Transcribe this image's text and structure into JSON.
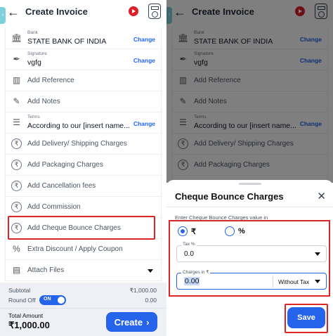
{
  "colors": {
    "accent": "#2563eb",
    "highlight": "#dc2626",
    "youtube": "#e11d2a"
  },
  "header": {
    "title": "Create Invoice"
  },
  "items": [
    {
      "small": "Bank",
      "value": "STATE BANK OF INDIA",
      "action": "Change",
      "icon": "bank-icon"
    },
    {
      "small": "Signature",
      "value": "vgfg",
      "action": "Change",
      "icon": "signature-icon"
    },
    {
      "label": "Add Reference",
      "icon": "reference-icon"
    },
    {
      "label": "Add Notes",
      "icon": "notes-icon"
    },
    {
      "small": "Terms",
      "value": "According to our [insert name...",
      "action": "Change",
      "icon": "terms-icon"
    },
    {
      "label": "Add Delivery/ Shipping Charges",
      "icon": "rupee-icon"
    },
    {
      "label": "Add Packaging Charges",
      "icon": "rupee-icon"
    },
    {
      "label": "Add Cancellation fees",
      "icon": "rupee-icon"
    },
    {
      "label": "Add Commission",
      "icon": "rupee-icon"
    },
    {
      "label": "Add Cheque Bounce Charges",
      "icon": "rupee-icon"
    },
    {
      "label": "Extra Discount / Apply Coupon",
      "icon": "percent-icon"
    },
    {
      "label": "Attach Files",
      "icon": "attach-icon"
    }
  ],
  "summary": {
    "subtotal_label": "Subtotal",
    "subtotal_value": "₹1,000.00",
    "roundoff_label": "Round Off",
    "roundoff_toggle": "ON",
    "roundoff_value": "0.00",
    "total_label": "Total Amount",
    "total_value": "₹1,000.00",
    "create_label": "Create"
  },
  "sheet": {
    "title": "Cheque Bounce Charges",
    "hint": "Enter Cheque Bounce Charges value in",
    "option_rupee": "₹",
    "option_percent": "%",
    "tax_label": "Tax %",
    "tax_value": "0.0",
    "charges_label": "Charges in ₹",
    "charges_value": "0.00",
    "tax_mode": "Without Tax",
    "save_label": "Save"
  }
}
